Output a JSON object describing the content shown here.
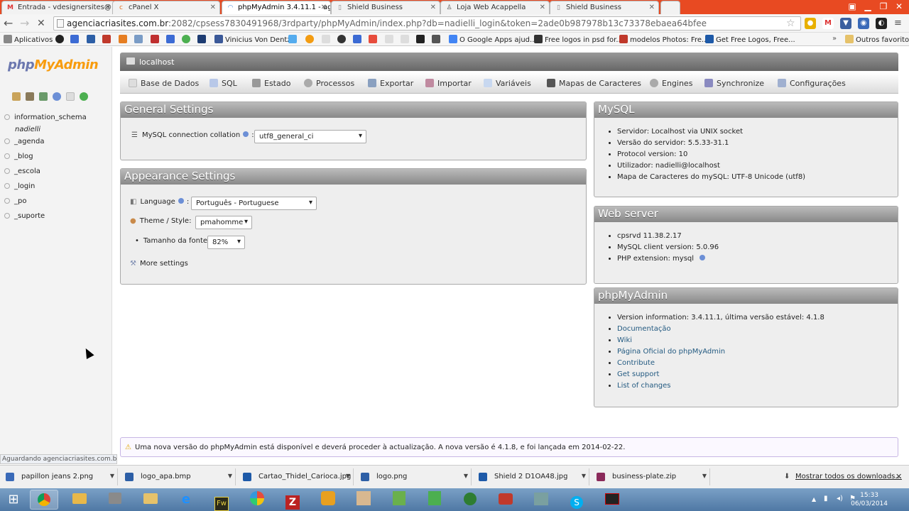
{
  "browser": {
    "tabs": [
      {
        "label": "Entrada - vdesignersites@",
        "icon": "gmail-icon"
      },
      {
        "label": "cPanel X",
        "icon": "cpanel-icon"
      },
      {
        "label": "phpMyAdmin 3.4.11.1 - ag",
        "icon": "loading-icon",
        "active": true
      },
      {
        "label": "Shield Business",
        "icon": "page-icon"
      },
      {
        "label": "Loja Web Acappella",
        "icon": "loja-icon"
      },
      {
        "label": "Shield Business",
        "icon": "page-icon"
      }
    ],
    "url_host": "agenciacriasites.com.br",
    "url_rest": ":2082/cpsess7830491968/3rdparty/phpMyAdmin/index.php?db=nadielli_login&token=2ade0b987978b13c73378ebaea64bfee",
    "bookmarks": [
      "Aplicativos",
      "Vinicius Von Dentz",
      "O Google Apps ajud...",
      "Free logos in psd for...",
      "modelos Photos: Fre...",
      "Get Free Logos, Free...",
      "Outros favoritos"
    ]
  },
  "pma": {
    "logo_a": "php",
    "logo_b": "MyAdmin",
    "databases": [
      "information_schema",
      "nadielli",
      "_agenda",
      "_blog",
      "_escola",
      "_login",
      "_po",
      "_suporte"
    ],
    "server": "localhost",
    "menu": [
      "Base de Dados",
      "SQL",
      "Estado",
      "Processos",
      "Exportar",
      "Importar",
      "Variáveis",
      "Mapas de Caracteres",
      "Engines",
      "Synchronize",
      "Configurações"
    ],
    "general": {
      "title": "General Settings",
      "collation_label": "MySQL connection collation",
      "collation_value": "utf8_general_ci"
    },
    "appearance": {
      "title": "Appearance Settings",
      "language_label": "Language",
      "language_value": "Português - Portuguese",
      "theme_label": "Theme / Style:",
      "theme_value": "pmahomme",
      "font_label": "Tamanho da fonte:",
      "font_value": "82%",
      "more": "More settings"
    },
    "mysql": {
      "title": "MySQL",
      "items": [
        "Servidor: Localhost via UNIX socket",
        "Versão do servidor: 5.5.33-31.1",
        "Protocol version: 10",
        "Utilizador: nadielli@localhost",
        "Mapa de Caracteres do mySQL: UTF-8 Unicode (utf8)"
      ]
    },
    "webserver": {
      "title": "Web server",
      "items": [
        "cpsrvd 11.38.2.17",
        "MySQL client version: 5.0.96",
        "PHP extension: mysql"
      ]
    },
    "phpmyadmin": {
      "title": "phpMyAdmin",
      "version": "Version information: 3.4.11.1, última versão estável: 4.1.8",
      "links": [
        "Documentação",
        "Wiki",
        "Página Oficial do phpMyAdmin",
        "Contribute",
        "Get support",
        "List of changes"
      ]
    },
    "notice": "Uma nova versão do phpMyAdmin está disponível e deverá proceder à actualização. A nova versão é 4.1.8, e foi lançada em 2014-02-22.",
    "status": "Aguardando agenciacriasites.com.br..."
  },
  "downloads": {
    "files": [
      "papillon jeans 2.png",
      "logo_apa.bmp",
      "Cartao_Thidel_Carioca.jpg",
      "logo.png",
      "Shield 2 D1OA48.jpg",
      "business-plate.zip"
    ],
    "show_all": "Mostrar todos os downloads..."
  },
  "taskbar": {
    "time": "15:33",
    "date": "06/03/2014"
  },
  "colors": {
    "chrome_frame": "#e84a22",
    "pma_header": "#888888",
    "link": "#235a81",
    "logo_php": "#6c78af",
    "logo_myadmin": "#f89c0e"
  }
}
